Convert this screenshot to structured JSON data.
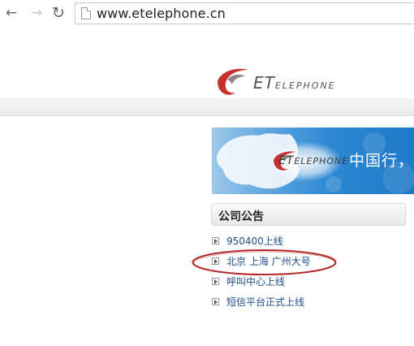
{
  "browser": {
    "back_icon": "arrow-left-icon",
    "forward_icon": "arrow-right-icon",
    "reload_icon": "reload-icon",
    "page_icon": "page-icon",
    "url": "www.etelephone.cn"
  },
  "header": {
    "logo_text_main": "ET",
    "logo_text_rest": "ELEPHONE",
    "logo_color": "#c8312b"
  },
  "banner": {
    "logo_text_main": "ET",
    "logo_text_rest": "ELEPHONE",
    "slogan": "中国行，"
  },
  "notices": {
    "title": "公司公告",
    "items": [
      {
        "label": "950400上线"
      },
      {
        "label": "北京 上海 广州大号"
      },
      {
        "label": "呼叫中心上线"
      },
      {
        "label": "短信平台正式上线"
      }
    ],
    "highlight_color": "#b3262a"
  }
}
